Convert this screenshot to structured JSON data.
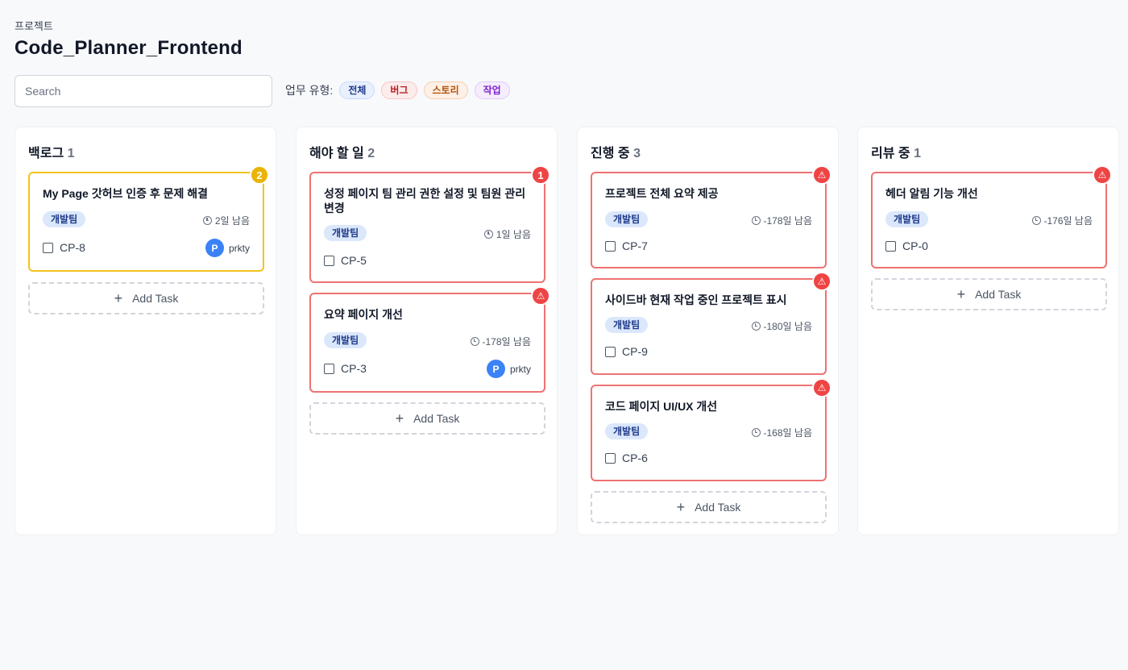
{
  "header": {
    "label": "프로젝트",
    "title": "Code_Planner_Frontend"
  },
  "search": {
    "placeholder": "Search"
  },
  "filter": {
    "label": "업무 유형:",
    "chips": [
      "전체",
      "버그",
      "스토리",
      "작업"
    ]
  },
  "add_task_label": "Add Task",
  "columns": [
    {
      "title": "백로그",
      "count": "1",
      "cards": [
        {
          "title": "My Page 갓허브 인증 후 문제 해결",
          "team": "개발팀",
          "due": "2일 남음",
          "key": "CP-8",
          "assignee_initial": "P",
          "assignee": "prkty",
          "badge": "2"
        }
      ]
    },
    {
      "title": "해야 할 일",
      "count": "2",
      "cards": [
        {
          "title": "성정 페이지 팀 관리 권한 설정 및 팀원 관리 변경",
          "team": "개발팀",
          "due": "1일 남음",
          "key": "CP-5",
          "badge": "1"
        },
        {
          "title": "요약 페이지 개선",
          "team": "개발팀",
          "due": "-178일 남음",
          "key": "CP-3",
          "assignee_initial": "P",
          "assignee": "prkty",
          "badge": "⚠"
        }
      ]
    },
    {
      "title": "진행 중",
      "count": "3",
      "cards": [
        {
          "title": "프로젝트 전체 요약 제공",
          "team": "개발팀",
          "due": "-178일 남음",
          "key": "CP-7",
          "badge": "⚠"
        },
        {
          "title": "사이드바 현재 작업 중인 프로젝트 표시",
          "team": "개발팀",
          "due": "-180일 남음",
          "key": "CP-9",
          "badge": "⚠"
        },
        {
          "title": "코드 페이지 UI/UX 개선",
          "team": "개발팀",
          "due": "-168일 남음",
          "key": "CP-6",
          "badge": "⚠"
        }
      ]
    },
    {
      "title": "리뷰 중",
      "count": "1",
      "cards": [
        {
          "title": "헤더 알림 기능 개선",
          "team": "개발팀",
          "due": "-176일 남음",
          "key": "CP-0",
          "badge": "⚠"
        }
      ]
    }
  ]
}
